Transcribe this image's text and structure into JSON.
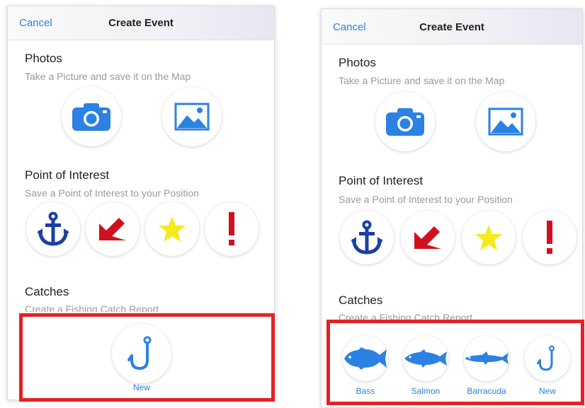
{
  "colors": {
    "accent": "#2b82e3",
    "anchor": "#1b3fa6",
    "marker_red": "#d0101f",
    "star_yellow": "#f5ea1c",
    "highlight": "#e52125"
  },
  "left": {
    "nav": {
      "cancel_label": "Cancel",
      "title": "Create Event"
    },
    "photos": {
      "title": "Photos",
      "subtitle": "Take a Picture and save it on the Map",
      "buttons": [
        {
          "icon": "camera-icon"
        },
        {
          "icon": "image-icon"
        }
      ]
    },
    "poi": {
      "title": "Point of Interest",
      "subtitle": "Save a Point of Interest to your Position",
      "buttons": [
        {
          "icon": "anchor-icon"
        },
        {
          "icon": "arrow-down-left-icon"
        },
        {
          "icon": "star-icon"
        },
        {
          "icon": "exclamation-icon"
        }
      ]
    },
    "catches": {
      "title": "Catches",
      "subtitle": "Create a Fishing Catch Report",
      "new_label": "New"
    }
  },
  "right": {
    "nav": {
      "cancel_label": "Cancel",
      "title": "Create Event"
    },
    "photos": {
      "title": "Photos",
      "subtitle": "Take a Picture and save it on the Map"
    },
    "poi": {
      "title": "Point of Interest",
      "subtitle": "Save a Point of Interest to your Position"
    },
    "catches": {
      "title": "Catches",
      "subtitle": "Create a Fishing Catch Report",
      "items": [
        {
          "label": "Bass",
          "icon": "bass-fish-icon"
        },
        {
          "label": "Salmon",
          "icon": "salmon-fish-icon"
        },
        {
          "label": "Barracuda",
          "icon": "barracuda-fish-icon"
        },
        {
          "label": "New",
          "icon": "fishing-hook-icon"
        }
      ]
    }
  }
}
